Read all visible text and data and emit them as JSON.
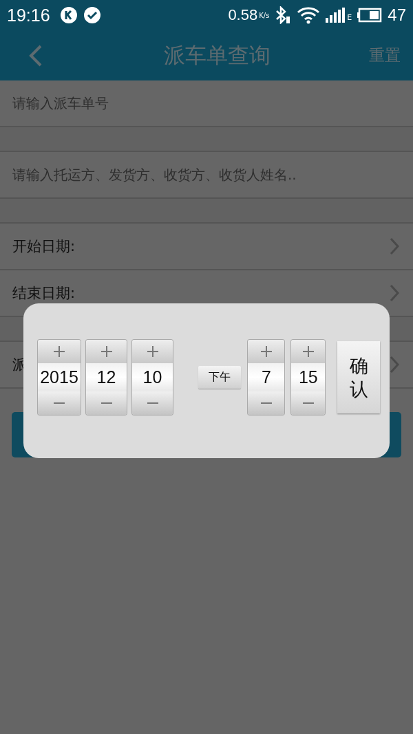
{
  "status_bar": {
    "time": "19:16",
    "speed": "0.58",
    "speed_unit": "K/s",
    "network_type": "E",
    "battery": "47"
  },
  "header": {
    "title": "派车单查询",
    "action": "重置"
  },
  "inputs": [
    {
      "placeholder": "请输入派车单号"
    },
    {
      "placeholder": "请输入托运方、发货方、收货方、收货人姓名.."
    }
  ],
  "rows": [
    {
      "label": "开始日期:"
    },
    {
      "label": "结束日期:"
    },
    {
      "label": "派"
    }
  ],
  "dialog": {
    "date": [
      {
        "value": "2015"
      },
      {
        "value": "12"
      },
      {
        "value": "10"
      }
    ],
    "period": "下午",
    "time": [
      {
        "value": "7"
      },
      {
        "value": "15"
      }
    ],
    "confirm": "确认"
  }
}
